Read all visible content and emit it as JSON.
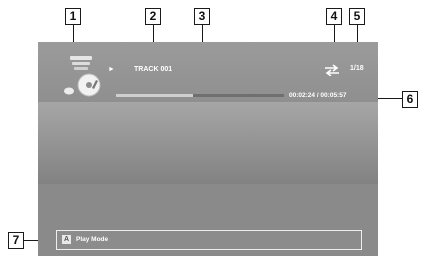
{
  "player": {
    "play_symbol": "►",
    "track_title": "TRACK 001",
    "track_position": "1/18",
    "elapsed_total": "00:02:24 / 00:05:57",
    "progress_fraction": 0.46,
    "repeat_icon": "repeat-icon",
    "album_icon": "music-cd-icon"
  },
  "footer": {
    "key_label": "A",
    "action_label": "Play Mode"
  },
  "callouts": {
    "c1": "1",
    "c2": "2",
    "c3": "3",
    "c4": "4",
    "c5": "5",
    "c6": "6",
    "c7": "7"
  },
  "colors": {
    "screen_bg": "#888888",
    "text": "#ffffff",
    "progress_fill": "#cfcfcf",
    "progress_track": "#6f6f6f"
  }
}
